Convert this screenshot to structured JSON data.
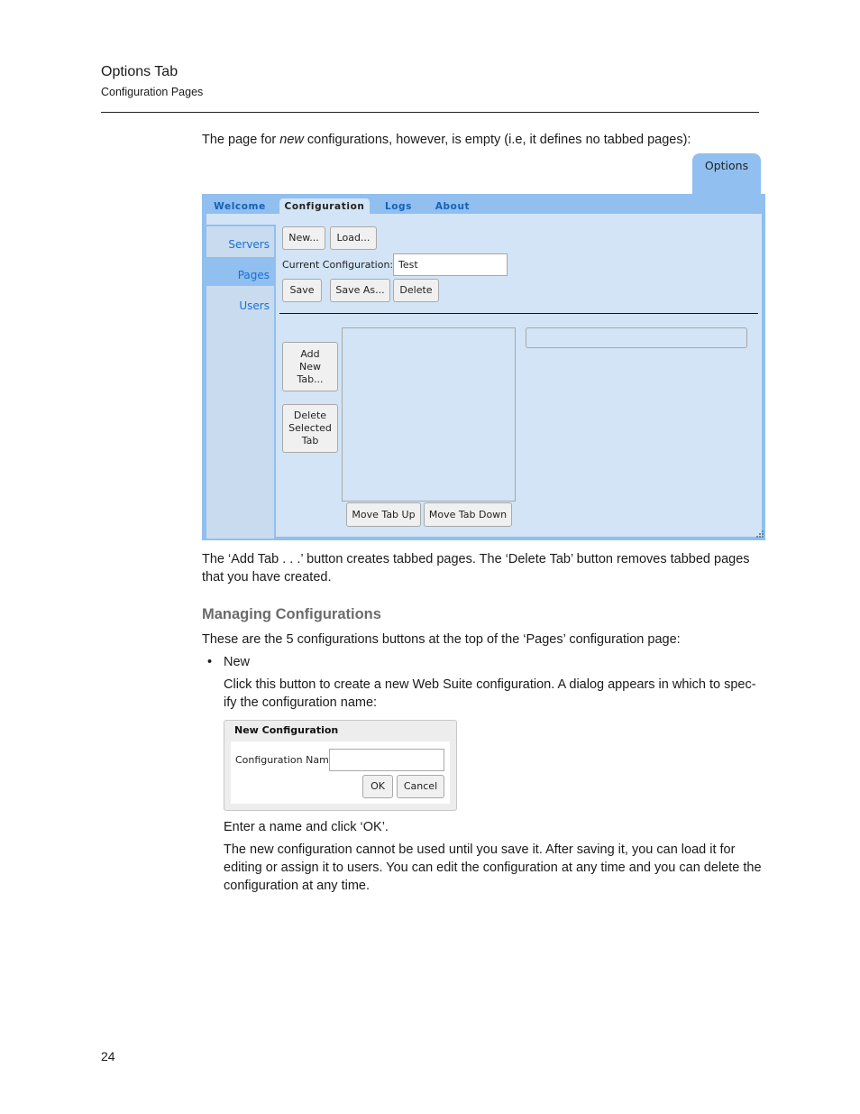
{
  "running_head": {
    "title": "Options Tab",
    "subtitle": "Configuration Pages"
  },
  "intro_text": {
    "before_em": "The page for ",
    "em": "new",
    "after_em": " configurations, however, is empty (i.e, it defines no tabbed pages):"
  },
  "screenshot": {
    "options_tab": "Options",
    "tabs": [
      {
        "label": "Welcome",
        "active": false
      },
      {
        "label": "Configuration",
        "active": true
      },
      {
        "label": "Logs",
        "active": false
      },
      {
        "label": "About",
        "active": false
      }
    ],
    "side_nav": [
      {
        "label": "Servers",
        "active": false
      },
      {
        "label": "Pages",
        "active": true
      },
      {
        "label": "Users",
        "active": false
      }
    ],
    "buttons": {
      "new": "New...",
      "load": "Load...",
      "save": "Save",
      "save_as": "Save As...",
      "delete": "Delete",
      "add_new_tab": "Add\nNew\nTab...",
      "delete_selected_tab": "Delete\nSelected\nTab",
      "move_tab_up": "Move Tab Up",
      "move_tab_down": "Move Tab Down"
    },
    "current_configuration_label": "Current Configuration:",
    "current_configuration_value": "Test",
    "colors": {
      "frame": "#90bff0",
      "panel": "#d2e4f5",
      "link": "#1560b8"
    }
  },
  "para_add_tab": "The ‘Add Tab . . .’ button creates tabbed pages. The ‘Delete Tab’ button removes tabbed pages that you have created.",
  "section_heading": "Managing Configurations",
  "para_intro": "These are the 5 configurations buttons at the top of the ‘Pages’ configuration page:",
  "bullet_glyph": "•",
  "bullet_label": "New",
  "para_new": "Click this button to create a new Web Suite configuration. A dialog appears in which to spec-ify the configuration name:",
  "dialog": {
    "title": "New Configuration",
    "field_label": "Configuration Name:",
    "field_value": "",
    "ok": "OK",
    "cancel": "Cancel"
  },
  "para_enter": "Enter a name and click ‘OK’.",
  "para_save": "The new configuration cannot be used until you save it. After saving it, you can load it for editing or assign it to users. You can edit the configuration at any time and you can delete the configuration at any time.",
  "page_number": "24"
}
